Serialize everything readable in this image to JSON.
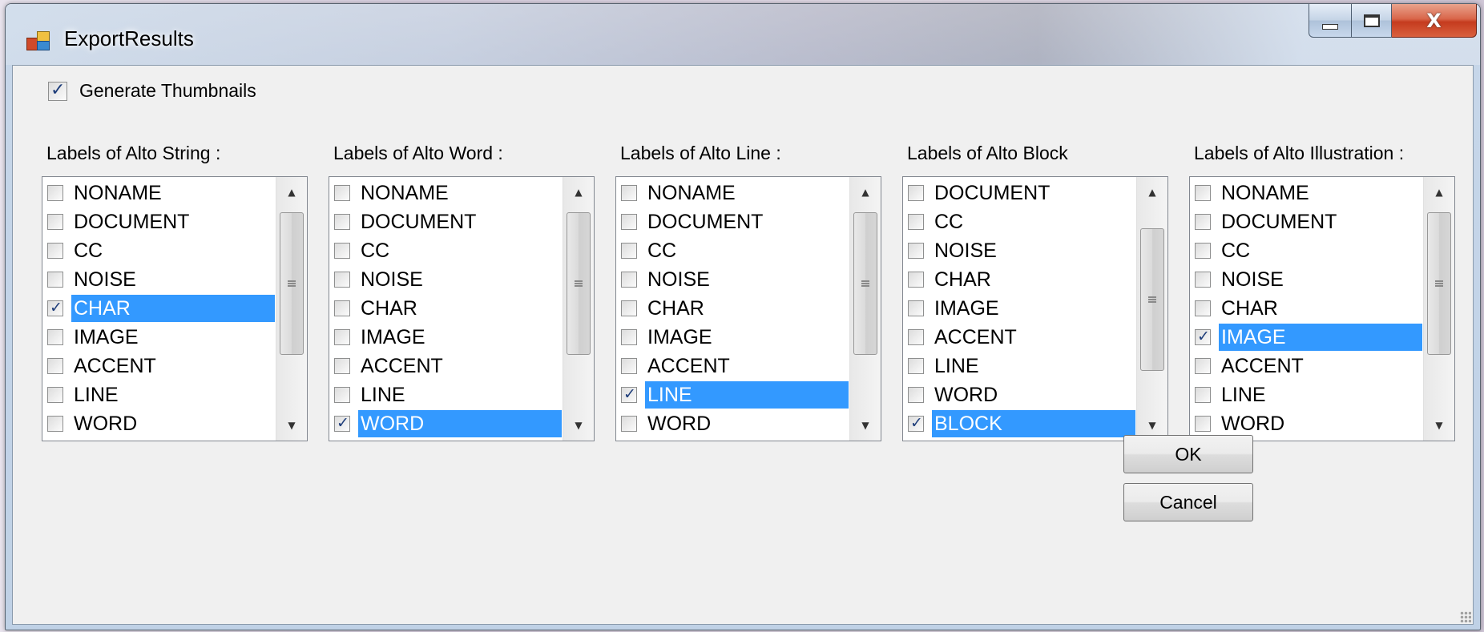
{
  "window": {
    "title": "ExportResults"
  },
  "generate_thumbnails": {
    "label": "Generate Thumbnails",
    "checked": true
  },
  "groups": [
    {
      "label": "Labels of Alto String :",
      "items": [
        {
          "label": "NONAME",
          "checked": false,
          "selected": false
        },
        {
          "label": "DOCUMENT",
          "checked": false,
          "selected": false
        },
        {
          "label": "CC",
          "checked": false,
          "selected": false
        },
        {
          "label": "NOISE",
          "checked": false,
          "selected": false
        },
        {
          "label": "CHAR",
          "checked": true,
          "selected": true
        },
        {
          "label": "IMAGE",
          "checked": false,
          "selected": false
        },
        {
          "label": "ACCENT",
          "checked": false,
          "selected": false
        },
        {
          "label": "LINE",
          "checked": false,
          "selected": false
        },
        {
          "label": "WORD",
          "checked": false,
          "selected": false
        }
      ]
    },
    {
      "label": "Labels of Alto Word :",
      "items": [
        {
          "label": "NONAME",
          "checked": false,
          "selected": false
        },
        {
          "label": "DOCUMENT",
          "checked": false,
          "selected": false
        },
        {
          "label": "CC",
          "checked": false,
          "selected": false
        },
        {
          "label": "NOISE",
          "checked": false,
          "selected": false
        },
        {
          "label": "CHAR",
          "checked": false,
          "selected": false
        },
        {
          "label": "IMAGE",
          "checked": false,
          "selected": false
        },
        {
          "label": "ACCENT",
          "checked": false,
          "selected": false
        },
        {
          "label": "LINE",
          "checked": false,
          "selected": false
        },
        {
          "label": "WORD",
          "checked": true,
          "selected": true
        }
      ]
    },
    {
      "label": "Labels of Alto Line :",
      "items": [
        {
          "label": "NONAME",
          "checked": false,
          "selected": false
        },
        {
          "label": "DOCUMENT",
          "checked": false,
          "selected": false
        },
        {
          "label": "CC",
          "checked": false,
          "selected": false
        },
        {
          "label": "NOISE",
          "checked": false,
          "selected": false
        },
        {
          "label": "CHAR",
          "checked": false,
          "selected": false
        },
        {
          "label": "IMAGE",
          "checked": false,
          "selected": false
        },
        {
          "label": "ACCENT",
          "checked": false,
          "selected": false
        },
        {
          "label": "LINE",
          "checked": true,
          "selected": true
        },
        {
          "label": "WORD",
          "checked": false,
          "selected": false
        }
      ]
    },
    {
      "label": "Labels of Alto Block",
      "items": [
        {
          "label": "DOCUMENT",
          "checked": false,
          "selected": false
        },
        {
          "label": "CC",
          "checked": false,
          "selected": false
        },
        {
          "label": "NOISE",
          "checked": false,
          "selected": false
        },
        {
          "label": "CHAR",
          "checked": false,
          "selected": false
        },
        {
          "label": "IMAGE",
          "checked": false,
          "selected": false
        },
        {
          "label": "ACCENT",
          "checked": false,
          "selected": false
        },
        {
          "label": "LINE",
          "checked": false,
          "selected": false
        },
        {
          "label": "WORD",
          "checked": false,
          "selected": false
        },
        {
          "label": "BLOCK",
          "checked": true,
          "selected": true
        }
      ]
    },
    {
      "label": "Labels of Alto Illustration :",
      "items": [
        {
          "label": "NONAME",
          "checked": false,
          "selected": false
        },
        {
          "label": "DOCUMENT",
          "checked": false,
          "selected": false
        },
        {
          "label": "CC",
          "checked": false,
          "selected": false
        },
        {
          "label": "NOISE",
          "checked": false,
          "selected": false
        },
        {
          "label": "CHAR",
          "checked": false,
          "selected": false
        },
        {
          "label": "IMAGE",
          "checked": true,
          "selected": true
        },
        {
          "label": "ACCENT",
          "checked": false,
          "selected": false
        },
        {
          "label": "LINE",
          "checked": false,
          "selected": false
        },
        {
          "label": "WORD",
          "checked": false,
          "selected": false
        }
      ]
    }
  ],
  "buttons": {
    "ok": "OK",
    "cancel": "Cancel"
  },
  "icons": {
    "app": "app-icon",
    "minimize": "minimize-icon",
    "maximize": "maximize-icon",
    "close": "close-icon",
    "scroll_up": "scroll-up-arrow-icon",
    "scroll_down": "scroll-down-arrow-icon"
  },
  "colors": {
    "selection": "#3399ff",
    "close_button": "#c53b1e",
    "dialog_bg": "#f0f0f0"
  }
}
